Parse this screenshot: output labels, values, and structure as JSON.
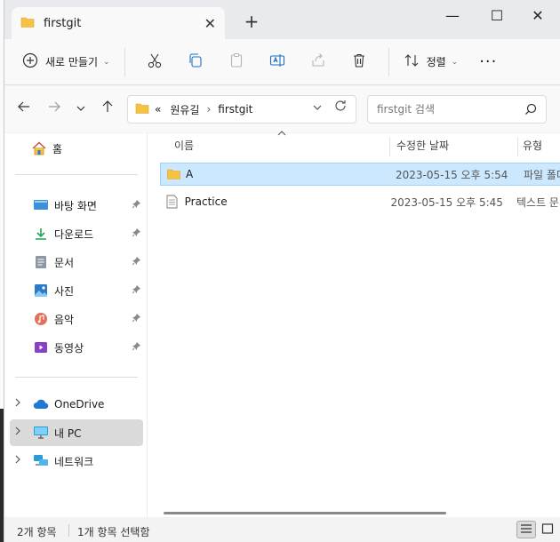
{
  "tab": {
    "title": "firstgit",
    "close": "✕"
  },
  "newtab": "+",
  "window_controls": {
    "minimize": "—",
    "maximize": "☐",
    "close": "✕"
  },
  "toolbar": {
    "new_label": "새로 만들기",
    "sort_label": "정렬",
    "more": "···"
  },
  "address": {
    "overflow": "«",
    "crumbs": [
      "원유길",
      "firstgit"
    ],
    "sep": "›"
  },
  "search": {
    "placeholder": "firstgit 검색"
  },
  "sidebar": {
    "home": "홈",
    "quick": [
      {
        "label": "바탕 화면"
      },
      {
        "label": "다운로드"
      },
      {
        "label": "문서"
      },
      {
        "label": "사진"
      },
      {
        "label": "음악"
      },
      {
        "label": "동영상"
      }
    ],
    "drives": [
      {
        "label": "OneDrive"
      },
      {
        "label": "내 PC"
      },
      {
        "label": "네트워크"
      }
    ]
  },
  "columns": {
    "name": "이름",
    "date": "수정한 날짜",
    "type": "유형"
  },
  "files": [
    {
      "name": "A",
      "date": "2023-05-15 오후 5:54",
      "type": "파일 폴더",
      "kind": "folder"
    },
    {
      "name": "Practice",
      "date": "2023-05-15 오후 5:45",
      "type": "텍스트 문서",
      "kind": "text"
    }
  ],
  "status": {
    "count": "2개 항목",
    "selected": "1개 항목 선택함"
  },
  "colors": {
    "folder": "#f6c243",
    "selection": "#cce8ff",
    "accent": "#0067c0"
  }
}
